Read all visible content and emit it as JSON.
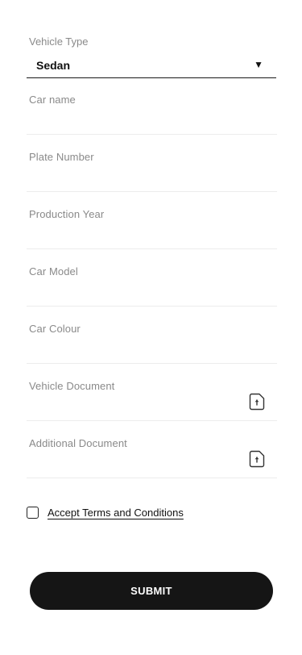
{
  "vehicle_type": {
    "label": "Vehicle Type",
    "selected": "Sedan",
    "caret_icon": "caret-down-icon"
  },
  "fields": [
    {
      "label": "Car name",
      "value": ""
    },
    {
      "label": "Plate Number",
      "value": ""
    },
    {
      "label": "Production Year",
      "value": ""
    },
    {
      "label": "Car Model",
      "value": ""
    },
    {
      "label": "Car Colour",
      "value": ""
    }
  ],
  "uploads": [
    {
      "label": "Vehicle Document",
      "icon": "upload-icon"
    },
    {
      "label": "Additional Document",
      "icon": "upload-icon"
    }
  ],
  "terms": {
    "label": "Accept Terms and Conditions",
    "checked": false
  },
  "submit": {
    "label": "SUBMIT"
  },
  "colors": {
    "primary": "#151515",
    "label": "#8a8a8a",
    "divider": "#ececec"
  }
}
